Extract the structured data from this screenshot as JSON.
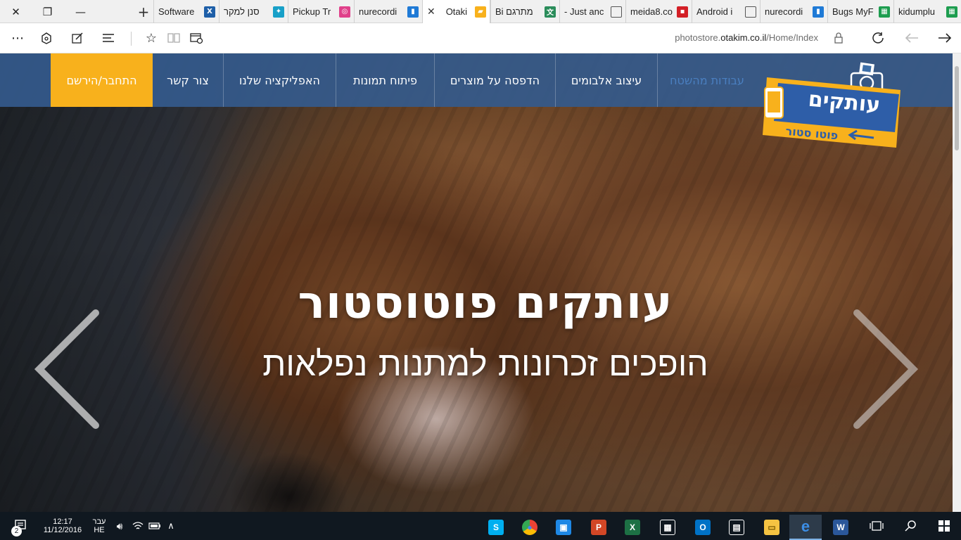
{
  "browser": {
    "tabs": [
      {
        "title": "Software",
        "icon": "x-icon",
        "color": "#1e5fa8"
      },
      {
        "title": "סנן למקר",
        "icon": "person-icon",
        "color": "#18a0c8"
      },
      {
        "title": "Pickup Tr",
        "icon": "pickup-icon",
        "color": "#e0408a"
      },
      {
        "title": "nurecordi",
        "icon": "trello-icon",
        "color": "#1f7ad6"
      },
      {
        "title": "Otaki",
        "icon": "otakim-icon",
        "color": "#f8b11c",
        "active": true
      },
      {
        "title": "Bi מתרגם",
        "icon": "translate-icon",
        "color": "#2a8c5a"
      },
      {
        "title": "- Just anc",
        "icon": "page-icon",
        "color": "#555555"
      },
      {
        "title": "meida8.co",
        "icon": "meida-icon",
        "color": "#d31f26"
      },
      {
        "title": "Android i",
        "icon": "page-icon",
        "color": "#555555"
      },
      {
        "title": "nurecordi",
        "icon": "trello-icon",
        "color": "#1f7ad6"
      },
      {
        "title": "Bugs MyF",
        "icon": "sheets-icon",
        "color": "#1d9d4f"
      },
      {
        "title": "kidumplu",
        "icon": "sheets-icon",
        "color": "#1d9d4f"
      }
    ],
    "url": {
      "prefix": "photostore.",
      "domain": "otakim.co.il",
      "path": "/Home/Index"
    }
  },
  "site": {
    "nav": {
      "items": [
        {
          "label": "עבודות מהשטח",
          "style": "faded"
        },
        {
          "label": "עיצוב אלבומים"
        },
        {
          "label": "הדפסה על מוצרים"
        },
        {
          "label": "פיתוח תמונות"
        },
        {
          "label": "האפליקציה שלנו"
        },
        {
          "label": "צור קשר"
        }
      ],
      "cta": "התחבר/הירשם"
    },
    "logo": {
      "line1": "עותקים",
      "line2": "פוטו סטור"
    },
    "hero": {
      "title": "עותקים פוטוסטור",
      "subtitle": "הופכים זכרונות למתנות נפלאות"
    },
    "colors": {
      "nav_bg": "#345a8c",
      "cta": "#f8b11c"
    }
  },
  "taskbar": {
    "notifications": "2",
    "time": "12:17",
    "date": "11/12/2016",
    "lang_top": "עבר",
    "lang": "HE",
    "apps": [
      {
        "icon": "skype-icon",
        "color": "#00aff0"
      },
      {
        "icon": "chrome-icon",
        "color": "#4caf50"
      },
      {
        "icon": "remote-icon",
        "color": "#1e88e5"
      },
      {
        "icon": "powerpoint-icon",
        "color": "#d24726"
      },
      {
        "icon": "excel-icon",
        "color": "#1d7044"
      },
      {
        "icon": "calculator-icon",
        "color": "#444444"
      },
      {
        "icon": "outlook-icon",
        "color": "#0072c6"
      },
      {
        "icon": "store-icon",
        "color": "#ffffff"
      },
      {
        "icon": "explorer-icon",
        "color": "#f5c342"
      },
      {
        "icon": "edge-icon",
        "color": "#3c8ee6",
        "active": true
      },
      {
        "icon": "word-icon",
        "color": "#2b579a"
      }
    ]
  }
}
